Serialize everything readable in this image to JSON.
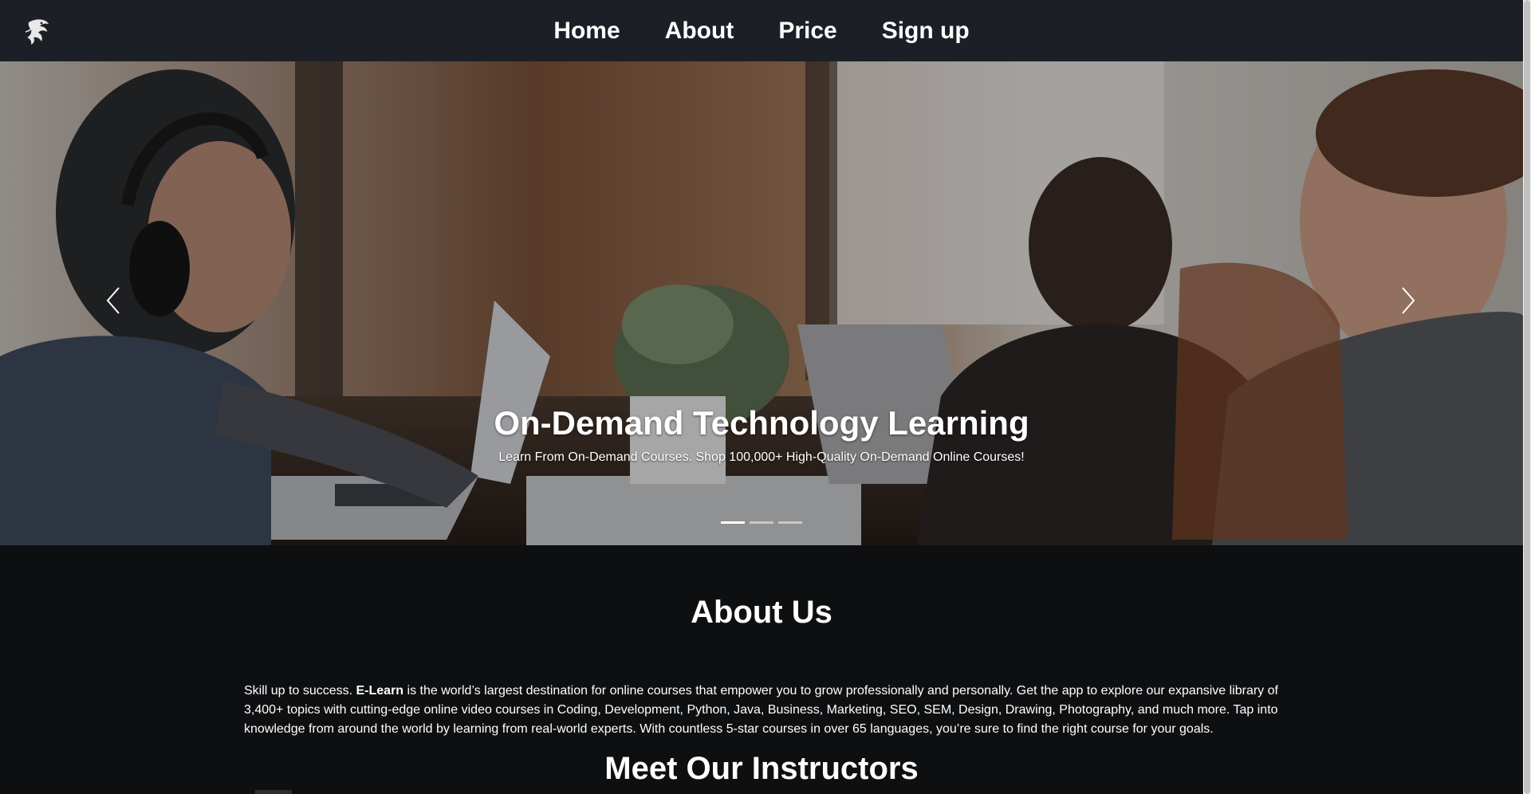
{
  "nav": {
    "logo_icon": "dragon-logo-icon",
    "links": [
      "Home",
      "About",
      "Price",
      "Sign up"
    ]
  },
  "hero": {
    "title": "On-Demand Technology Learning",
    "subtitle": "Learn From On-Demand Courses. Shop 100,000+ High-Quality On-Demand Online Courses!",
    "prev_icon": "chevron-left-icon",
    "next_icon": "chevron-right-icon",
    "slides_count": 3,
    "active_slide": 1
  },
  "about": {
    "heading": "About Us",
    "text_intro": "Skill up to success. ",
    "brand": "E-Learn",
    "text_body": " is the world’s largest destination for online courses that empower you to grow professionally and personally. Get the app to explore our expansive library of 3,400+ topics with cutting-edge online video courses in Coding, Development, Python, Java, Business, Marketing, SEO, SEM, Design, Drawing, Photography, and much more. Tap into knowledge from around the world by learning from real-world experts. With countless 5-star courses in over 65 languages, you’re sure to find the right course for your goals."
  },
  "instructors": {
    "heading": "Meet Our Instructors"
  },
  "colors": {
    "navbar_bg": "#1c2026",
    "page_bg": "#0e0f11",
    "text": "#ffffff"
  }
}
